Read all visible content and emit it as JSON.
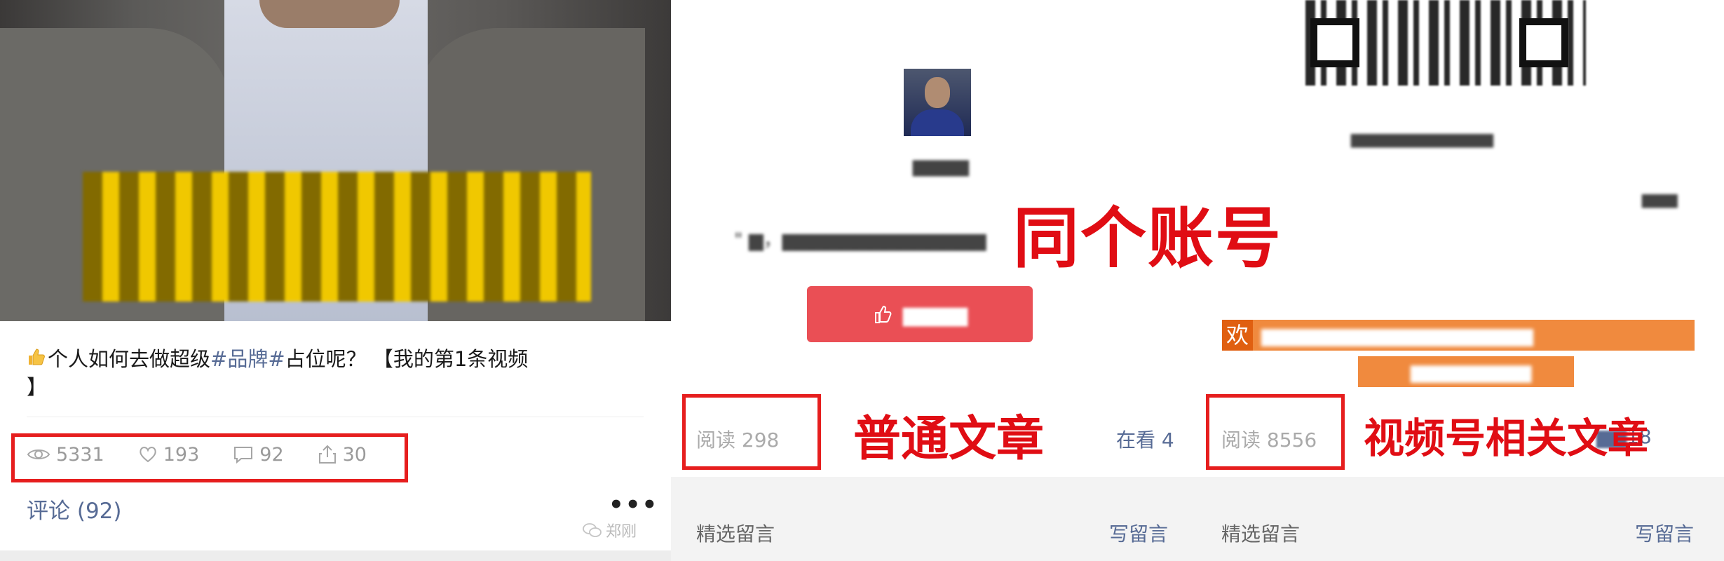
{
  "video_post": {
    "title_prefix": "个人如何去做超级",
    "title_hashtag": "#品牌#",
    "title_suffix": "占位呢？ 【我的第1条视频",
    "title_line2": "】",
    "stats": {
      "views": "5331",
      "likes": "193",
      "comments": "92",
      "shares": "30"
    },
    "comments_label": "评论 (92)",
    "more_label": "•••",
    "watermark_name": "郑刚"
  },
  "article_compare": {
    "big_title": "同个账号",
    "normal_article": {
      "read_label": "阅读 298",
      "watching_label": "在看 4",
      "annotation": "普通文章",
      "selected_comments": "精选留言",
      "write_comment": "写留言"
    },
    "video_article": {
      "read_label": "阅读 8556",
      "watching_visible": "18",
      "annotation": "视频号相关文章",
      "selected_comments": "精选留言",
      "write_comment": "写留言",
      "banner_first_char": "欢"
    }
  },
  "colors": {
    "red_highlight": "#e00d14",
    "link_blue": "#576b95",
    "follow_button": "#ea4f55",
    "banner_orange": "#f08a3e"
  },
  "icons": [
    "thumbs-up-icon",
    "eye-icon",
    "heart-icon",
    "comment-icon",
    "share-icon",
    "wechat-icon",
    "like-hand-icon"
  ]
}
